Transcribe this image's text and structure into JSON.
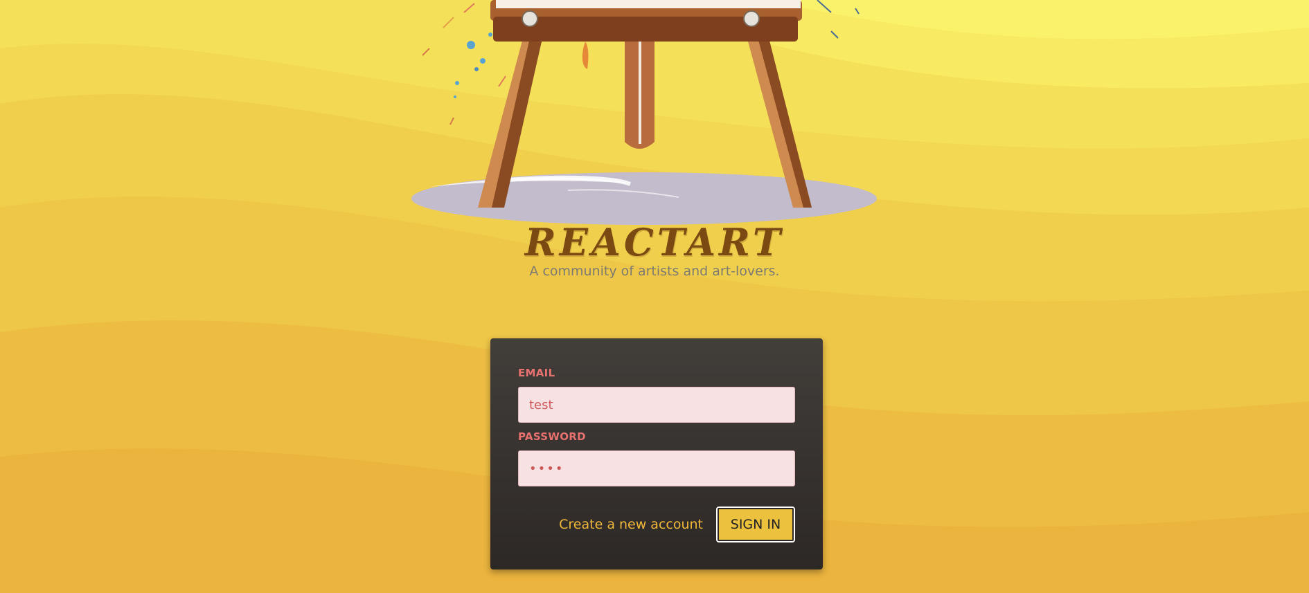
{
  "app": {
    "title": "REACTART",
    "tagline": "A community of artists and art-lovers."
  },
  "illustration": {
    "name": "painting-easel-illustration"
  },
  "form": {
    "email_label": "EMAIL",
    "email_value": "test",
    "password_label": "PASSWORD",
    "password_value": "test",
    "create_account_label": "Create a new account",
    "signin_label": "SIGN IN"
  },
  "colors": {
    "background": "#f2c94c",
    "brand_title": "#7a4a12",
    "card": "#3a3532",
    "label": "#e6716f",
    "input_bg": "#f8e1e3",
    "link": "#f0b93a",
    "button": "#ecc13e"
  }
}
